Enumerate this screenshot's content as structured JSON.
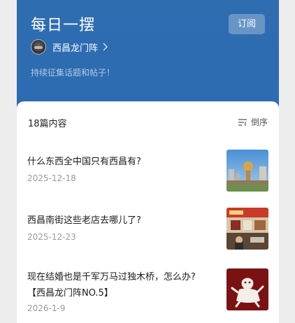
{
  "header": {
    "title": "每日一摆",
    "subscribe_label": "订阅",
    "author_name": "西昌龙门阵",
    "slogan": "持续征集话题和帖子！"
  },
  "list_header": {
    "count_text": "18篇内容",
    "sort_label": "倒序"
  },
  "articles": [
    {
      "title": "什么东西全中国只有西昌有?",
      "date": "2025-12-18",
      "thumb": "city-square-photo"
    },
    {
      "title": "西昌南街这些老店去哪儿了?",
      "date": "2025-12-23",
      "thumb": "old-street-shop-photo"
    },
    {
      "title_line1": "现在结婚也是千军万马过独木桥，怎么办?",
      "title_line2": "【西昌龙门阵NO.5】",
      "date": "2026-1-9",
      "thumb": "wedding-illustration"
    }
  ],
  "colors": {
    "header_blue": "#2b6bb4",
    "card_bg": "#ffffff",
    "page_bg": "#ededed",
    "date_gray": "#9a9a9a",
    "thumb3_red": "#7a1214"
  }
}
